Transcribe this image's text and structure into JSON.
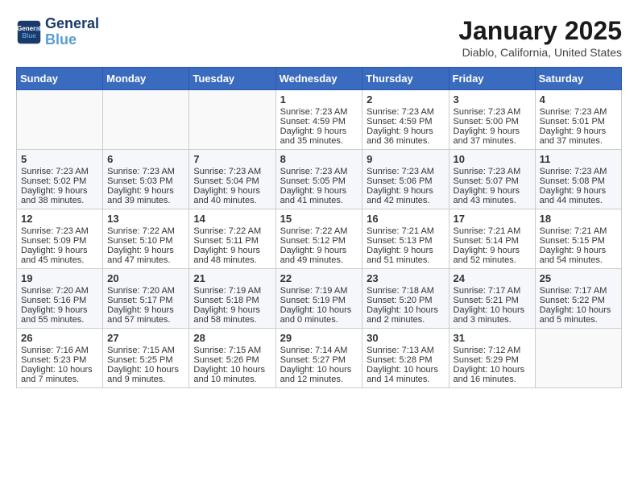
{
  "header": {
    "logo_line1": "General",
    "logo_line2": "Blue",
    "month_title": "January 2025",
    "location": "Diablo, California, United States"
  },
  "weekdays": [
    "Sunday",
    "Monday",
    "Tuesday",
    "Wednesday",
    "Thursday",
    "Friday",
    "Saturday"
  ],
  "weeks": [
    [
      {
        "day": "",
        "content": ""
      },
      {
        "day": "",
        "content": ""
      },
      {
        "day": "",
        "content": ""
      },
      {
        "day": "1",
        "content": "Sunrise: 7:23 AM\nSunset: 4:59 PM\nDaylight: 9 hours\nand 35 minutes."
      },
      {
        "day": "2",
        "content": "Sunrise: 7:23 AM\nSunset: 4:59 PM\nDaylight: 9 hours\nand 36 minutes."
      },
      {
        "day": "3",
        "content": "Sunrise: 7:23 AM\nSunset: 5:00 PM\nDaylight: 9 hours\nand 37 minutes."
      },
      {
        "day": "4",
        "content": "Sunrise: 7:23 AM\nSunset: 5:01 PM\nDaylight: 9 hours\nand 37 minutes."
      }
    ],
    [
      {
        "day": "5",
        "content": "Sunrise: 7:23 AM\nSunset: 5:02 PM\nDaylight: 9 hours\nand 38 minutes."
      },
      {
        "day": "6",
        "content": "Sunrise: 7:23 AM\nSunset: 5:03 PM\nDaylight: 9 hours\nand 39 minutes."
      },
      {
        "day": "7",
        "content": "Sunrise: 7:23 AM\nSunset: 5:04 PM\nDaylight: 9 hours\nand 40 minutes."
      },
      {
        "day": "8",
        "content": "Sunrise: 7:23 AM\nSunset: 5:05 PM\nDaylight: 9 hours\nand 41 minutes."
      },
      {
        "day": "9",
        "content": "Sunrise: 7:23 AM\nSunset: 5:06 PM\nDaylight: 9 hours\nand 42 minutes."
      },
      {
        "day": "10",
        "content": "Sunrise: 7:23 AM\nSunset: 5:07 PM\nDaylight: 9 hours\nand 43 minutes."
      },
      {
        "day": "11",
        "content": "Sunrise: 7:23 AM\nSunset: 5:08 PM\nDaylight: 9 hours\nand 44 minutes."
      }
    ],
    [
      {
        "day": "12",
        "content": "Sunrise: 7:23 AM\nSunset: 5:09 PM\nDaylight: 9 hours\nand 45 minutes."
      },
      {
        "day": "13",
        "content": "Sunrise: 7:22 AM\nSunset: 5:10 PM\nDaylight: 9 hours\nand 47 minutes."
      },
      {
        "day": "14",
        "content": "Sunrise: 7:22 AM\nSunset: 5:11 PM\nDaylight: 9 hours\nand 48 minutes."
      },
      {
        "day": "15",
        "content": "Sunrise: 7:22 AM\nSunset: 5:12 PM\nDaylight: 9 hours\nand 49 minutes."
      },
      {
        "day": "16",
        "content": "Sunrise: 7:21 AM\nSunset: 5:13 PM\nDaylight: 9 hours\nand 51 minutes."
      },
      {
        "day": "17",
        "content": "Sunrise: 7:21 AM\nSunset: 5:14 PM\nDaylight: 9 hours\nand 52 minutes."
      },
      {
        "day": "18",
        "content": "Sunrise: 7:21 AM\nSunset: 5:15 PM\nDaylight: 9 hours\nand 54 minutes."
      }
    ],
    [
      {
        "day": "19",
        "content": "Sunrise: 7:20 AM\nSunset: 5:16 PM\nDaylight: 9 hours\nand 55 minutes."
      },
      {
        "day": "20",
        "content": "Sunrise: 7:20 AM\nSunset: 5:17 PM\nDaylight: 9 hours\nand 57 minutes."
      },
      {
        "day": "21",
        "content": "Sunrise: 7:19 AM\nSunset: 5:18 PM\nDaylight: 9 hours\nand 58 minutes."
      },
      {
        "day": "22",
        "content": "Sunrise: 7:19 AM\nSunset: 5:19 PM\nDaylight: 10 hours\nand 0 minutes."
      },
      {
        "day": "23",
        "content": "Sunrise: 7:18 AM\nSunset: 5:20 PM\nDaylight: 10 hours\nand 2 minutes."
      },
      {
        "day": "24",
        "content": "Sunrise: 7:17 AM\nSunset: 5:21 PM\nDaylight: 10 hours\nand 3 minutes."
      },
      {
        "day": "25",
        "content": "Sunrise: 7:17 AM\nSunset: 5:22 PM\nDaylight: 10 hours\nand 5 minutes."
      }
    ],
    [
      {
        "day": "26",
        "content": "Sunrise: 7:16 AM\nSunset: 5:23 PM\nDaylight: 10 hours\nand 7 minutes."
      },
      {
        "day": "27",
        "content": "Sunrise: 7:15 AM\nSunset: 5:25 PM\nDaylight: 10 hours\nand 9 minutes."
      },
      {
        "day": "28",
        "content": "Sunrise: 7:15 AM\nSunset: 5:26 PM\nDaylight: 10 hours\nand 10 minutes."
      },
      {
        "day": "29",
        "content": "Sunrise: 7:14 AM\nSunset: 5:27 PM\nDaylight: 10 hours\nand 12 minutes."
      },
      {
        "day": "30",
        "content": "Sunrise: 7:13 AM\nSunset: 5:28 PM\nDaylight: 10 hours\nand 14 minutes."
      },
      {
        "day": "31",
        "content": "Sunrise: 7:12 AM\nSunset: 5:29 PM\nDaylight: 10 hours\nand 16 minutes."
      },
      {
        "day": "",
        "content": ""
      }
    ]
  ]
}
